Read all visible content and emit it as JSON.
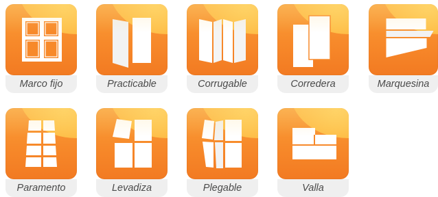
{
  "tiles": [
    {
      "label": "Marco fijo",
      "icon": "fixed-frame-window-icon"
    },
    {
      "label": "Practicable",
      "icon": "casement-window-icon"
    },
    {
      "label": "Corrugable",
      "icon": "folding-panel-icon"
    },
    {
      "label": "Corredera",
      "icon": "sliding-window-icon"
    },
    {
      "label": "Marquesina",
      "icon": "awning-window-icon"
    },
    {
      "label": "Paramento",
      "icon": "wall-panel-icon"
    },
    {
      "label": "Levadiza",
      "icon": "lift-window-icon"
    },
    {
      "label": "Plegable",
      "icon": "bifold-window-icon"
    },
    {
      "label": "Valla",
      "icon": "fence-icon"
    }
  ],
  "colors": {
    "tile_orange": "#f7892a",
    "tile_highlight": "#ffd25a",
    "label_bg": "#efefef",
    "label_text": "#4a4a4a",
    "glyph": "#ffffff"
  }
}
